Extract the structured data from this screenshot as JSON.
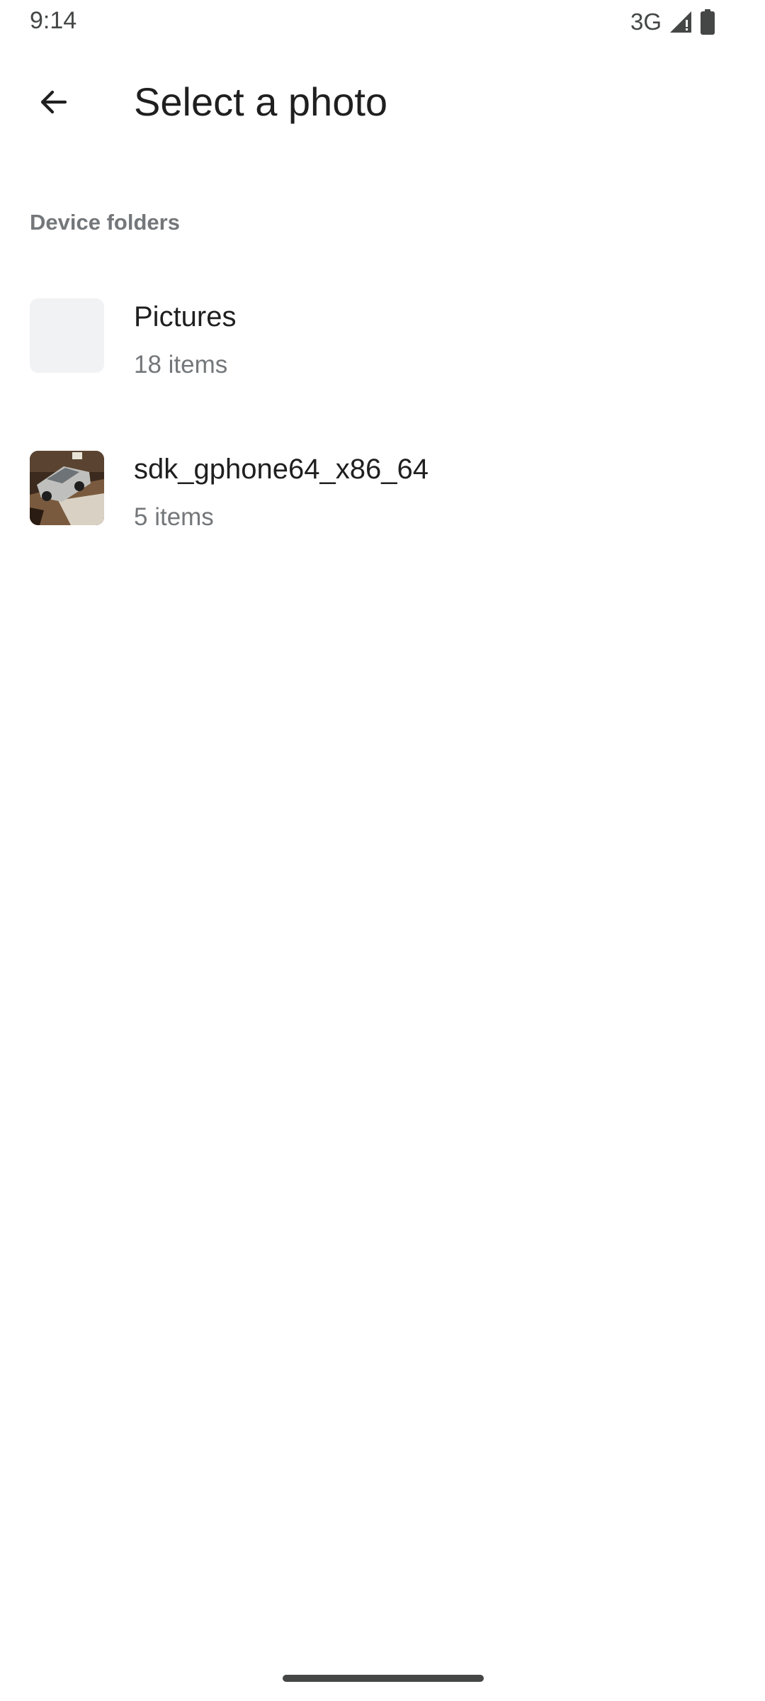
{
  "status_bar": {
    "time": "9:14",
    "network": "3G",
    "icons": [
      "signal-icon",
      "battery-icon"
    ]
  },
  "app_bar": {
    "back_icon": "arrow-back-icon",
    "title": "Select a photo"
  },
  "section": {
    "header": "Device folders"
  },
  "folders": [
    {
      "name": "Pictures",
      "count": "18 items",
      "thumbnail": "empty"
    },
    {
      "name": "sdk_gphone64_x86_64",
      "count": "5 items",
      "thumbnail": "photo-of-toy-car"
    }
  ],
  "colors": {
    "text_primary": "#1f1f1f",
    "text_secondary": "#74777a",
    "thumb_placeholder": "#f1f2f4",
    "background": "#ffffff"
  }
}
